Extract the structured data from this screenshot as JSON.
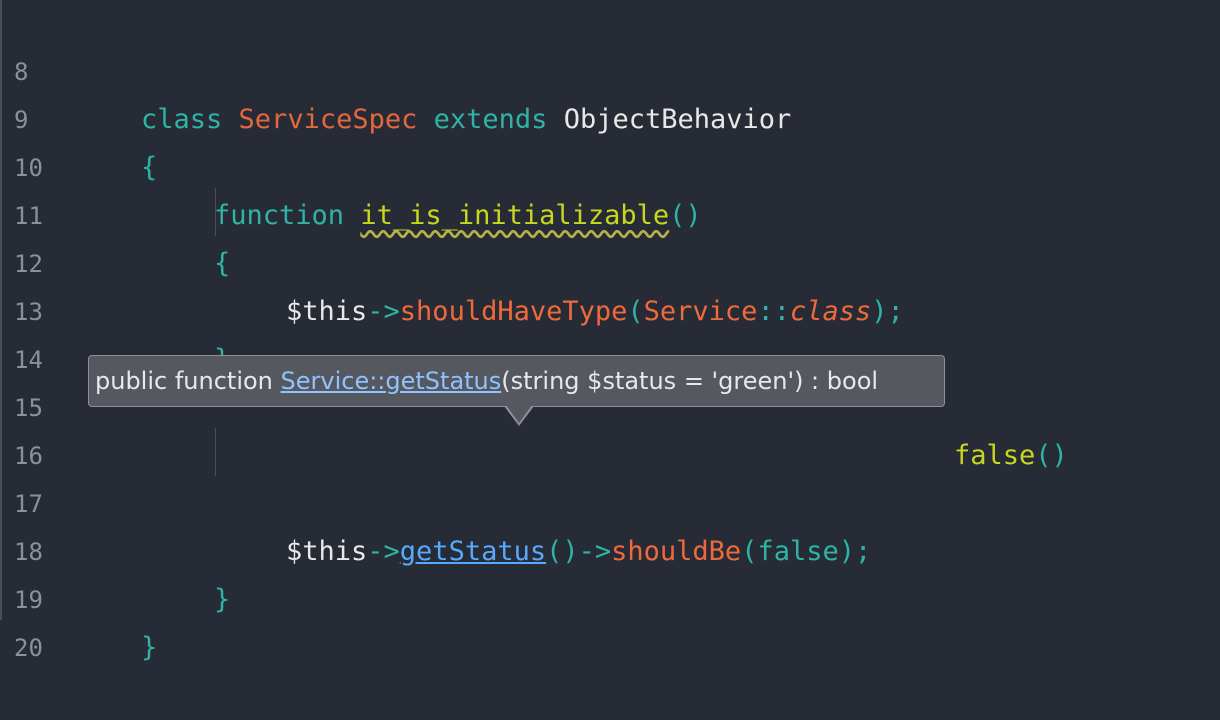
{
  "lines": [
    {
      "num": "8",
      "tokens": [
        "class",
        "ServiceSpec",
        "extends",
        "ObjectBehavior"
      ]
    },
    {
      "num": "9",
      "tokens": [
        "{"
      ]
    },
    {
      "num": "10",
      "tokens": [
        "function",
        "it_is_initializable",
        "()"
      ]
    },
    {
      "num": "11",
      "tokens": [
        "{"
      ]
    },
    {
      "num": "12",
      "tokens": [
        "$this",
        "->",
        "shouldHaveType",
        "(",
        "Service",
        "::",
        "class",
        ");"
      ]
    },
    {
      "num": "13",
      "tokens": [
        "}"
      ]
    },
    {
      "num": "14",
      "tokens": []
    },
    {
      "num": "15",
      "tokens": [
        "false",
        "()"
      ]
    },
    {
      "num": "16",
      "tokens": []
    },
    {
      "num": "17",
      "tokens": [
        "$this",
        "->",
        "getStatus",
        "()",
        "->",
        "shouldBe",
        "(",
        "false",
        ");"
      ]
    },
    {
      "num": "18",
      "tokens": [
        "}"
      ]
    },
    {
      "num": "19",
      "tokens": [
        "}"
      ]
    },
    {
      "num": "20",
      "tokens": []
    }
  ],
  "tooltip": {
    "prefix": "public function ",
    "link": "Service::getStatus",
    "suffix": "(string $status = 'green') : bool"
  }
}
